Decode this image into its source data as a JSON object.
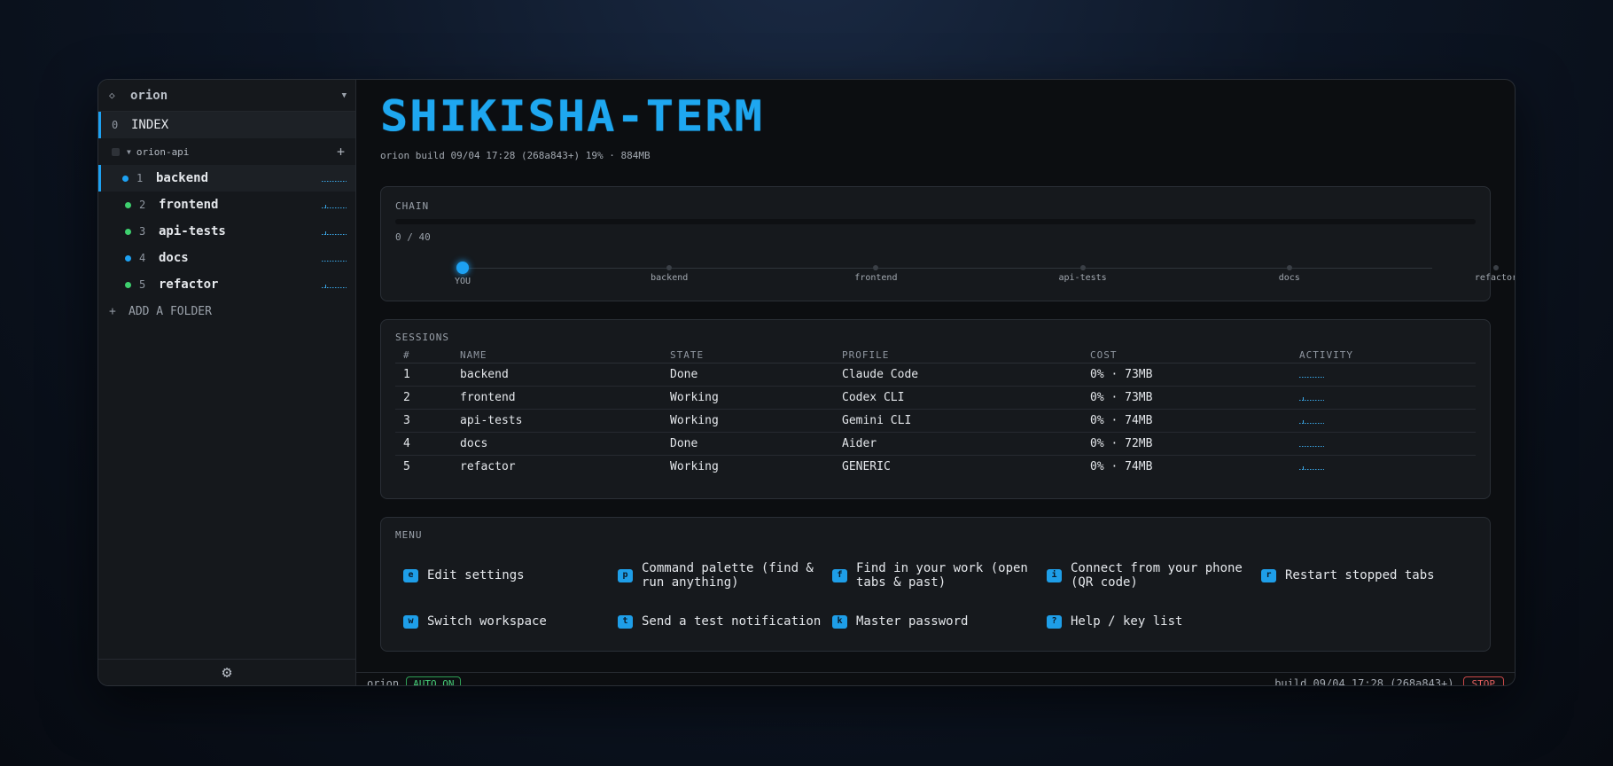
{
  "workspace": {
    "name": "orion"
  },
  "sidebar": {
    "index": {
      "num": "0",
      "label": "INDEX"
    },
    "folder": {
      "name": "orion-api"
    },
    "items": [
      {
        "num": "1",
        "label": "backend",
        "dot": "#1da1f2"
      },
      {
        "num": "2",
        "label": "frontend",
        "dot": "#3ecf6e"
      },
      {
        "num": "3",
        "label": "api-tests",
        "dot": "#3ecf6e"
      },
      {
        "num": "4",
        "label": "docs",
        "dot": "#1da1f2"
      },
      {
        "num": "5",
        "label": "refactor",
        "dot": "#3ecf6e"
      }
    ],
    "add_folder": "ADD A FOLDER"
  },
  "header": {
    "logo": "SHIKISHA-TERM",
    "build": "orion build 09/04 17:28 (268a843+) 19% · 884MB"
  },
  "chain": {
    "title": "CHAIN",
    "progress": "0 / 40",
    "progress_fraction": 0,
    "nodes": [
      "YOU",
      "backend",
      "frontend",
      "api-tests",
      "docs",
      "refactor"
    ]
  },
  "sessions": {
    "title": "SESSIONS",
    "columns": [
      "#",
      "NAME",
      "STATE",
      "PROFILE",
      "COST",
      "ACTIVITY"
    ],
    "rows": [
      {
        "num": "1",
        "name": "backend",
        "state": "Done",
        "profile": "Claude Code",
        "cost": "0% · 73MB"
      },
      {
        "num": "2",
        "name": "frontend",
        "state": "Working",
        "profile": "Codex CLI",
        "cost": "0% · 73MB"
      },
      {
        "num": "3",
        "name": "api-tests",
        "state": "Working",
        "profile": "Gemini CLI",
        "cost": "0% · 74MB"
      },
      {
        "num": "4",
        "name": "docs",
        "state": "Done",
        "profile": "Aider",
        "cost": "0% · 72MB"
      },
      {
        "num": "5",
        "name": "refactor",
        "state": "Working",
        "profile": "GENERIC",
        "cost": "0% · 74MB"
      }
    ]
  },
  "menu": {
    "title": "MENU",
    "items": [
      {
        "key": "e",
        "label": "Edit settings"
      },
      {
        "key": "p",
        "label": "Command palette (find & run anything)"
      },
      {
        "key": "f",
        "label": "Find in your work (open tabs & past)"
      },
      {
        "key": "i",
        "label": "Connect from your phone (QR code)"
      },
      {
        "key": "r",
        "label": "Restart stopped tabs"
      },
      {
        "key": "w",
        "label": "Switch workspace"
      },
      {
        "key": "t",
        "label": "Send a test notification"
      },
      {
        "key": "k",
        "label": "Master password"
      },
      {
        "key": "?",
        "label": "Help / key list"
      }
    ]
  },
  "statusbar": {
    "workspace": "orion",
    "auto": "AUTO ON",
    "build": "build 09/04 17:28 (268a843+)",
    "stop": "STOP"
  }
}
